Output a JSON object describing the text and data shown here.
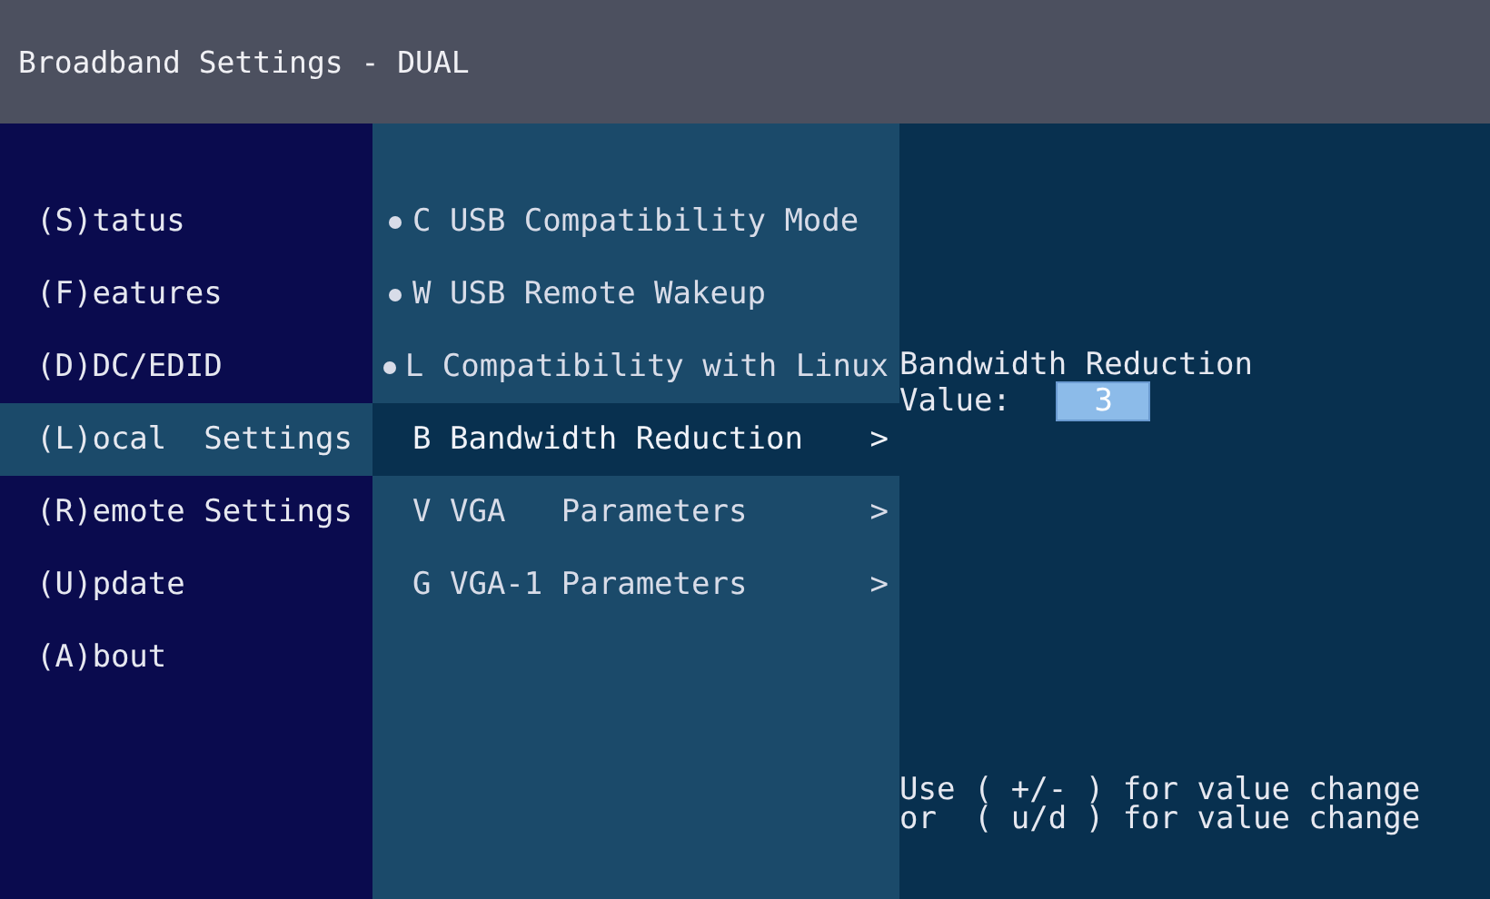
{
  "window": {
    "title": "Broadband Settings - DUAL"
  },
  "sidebar": {
    "items": [
      {
        "label": "(S)tatus",
        "selected": false
      },
      {
        "label": "(F)eatures",
        "selected": false
      },
      {
        "label": "(D)DC/EDID",
        "selected": false
      },
      {
        "label": "(L)ocal  Settings",
        "selected": true
      },
      {
        "label": "(R)emote Settings",
        "selected": false
      },
      {
        "label": "(U)pdate",
        "selected": false
      },
      {
        "label": "(A)bout",
        "selected": false
      }
    ]
  },
  "submenu": {
    "items": [
      {
        "kind": "option",
        "label": "C USB Compatibility Mode",
        "checked": true,
        "selected": false
      },
      {
        "kind": "option",
        "label": "W USB Remote Wakeup",
        "checked": true,
        "selected": false
      },
      {
        "kind": "option",
        "label": "L Compatibility with Linux",
        "checked": true,
        "selected": false
      },
      {
        "kind": "submenu",
        "label": "B Bandwidth Reduction",
        "arrow": ">",
        "selected": true
      },
      {
        "kind": "submenu",
        "label": "V VGA   Parameters",
        "arrow": ">",
        "selected": false
      },
      {
        "kind": "submenu",
        "label": "G VGA-1 Parameters",
        "arrow": ">",
        "selected": false
      }
    ]
  },
  "detail": {
    "title": "Bandwidth Reduction",
    "value_label": "Value:",
    "value": "3",
    "help": [
      "Use ( +/- ) for value change",
      "or  ( u/d ) for value change"
    ]
  }
}
